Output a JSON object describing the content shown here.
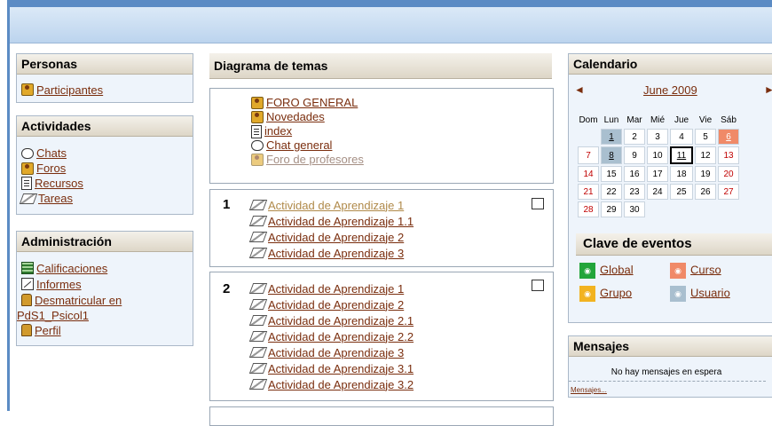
{
  "left": {
    "personas": {
      "title": "Personas",
      "items": [
        {
          "label": "Participantes",
          "icon": "people-icon"
        }
      ]
    },
    "actividades": {
      "title": "Actividades",
      "items": [
        {
          "label": "Chats",
          "icon": "chat-icon"
        },
        {
          "label": "Foros",
          "icon": "people-icon"
        },
        {
          "label": "Recursos",
          "icon": "document-icon"
        },
        {
          "label": "Tareas",
          "icon": "assignment-icon"
        }
      ]
    },
    "administracion": {
      "title": "Administración",
      "items": [
        {
          "label": "Calificaciones",
          "icon": "grades-icon"
        },
        {
          "label": "Informes",
          "icon": "report-icon"
        },
        {
          "label": "Desmatricular en",
          "label2": "PdS1_Psicol1",
          "icon": "person-icon"
        },
        {
          "label": "Perfil",
          "icon": "person-icon"
        }
      ]
    }
  },
  "center": {
    "title": "Diagrama de temas",
    "section0": [
      {
        "label": "FORO GENERAL",
        "icon": "people-icon"
      },
      {
        "label": "Novedades",
        "icon": "people-icon"
      },
      {
        "label": "index",
        "icon": "document-icon"
      },
      {
        "label": "Chat general",
        "icon": "chat-icon"
      },
      {
        "label": "Foro de profesores",
        "icon": "people-icon",
        "dimmed": true
      }
    ],
    "section1": {
      "number": "1",
      "items": [
        "Actividad de Aprendizaje 1",
        "Actividad de Aprendizaje 1.1",
        "Actividad de Aprendizaje 2",
        "Actividad de Aprendizaje 3"
      ]
    },
    "section2": {
      "number": "2",
      "items": [
        "Actividad de Aprendizaje 1",
        "Actividad de Aprendizaje 2",
        "Actividad de Aprendizaje 2.1",
        "Actividad de Aprendizaje 2.2",
        "Actividad de Aprendizaje 3",
        "Actividad de Aprendizaje 3.1",
        "Actividad de Aprendizaje 3.2"
      ]
    }
  },
  "right": {
    "calendar": {
      "title": "Calendario",
      "month": "June 2009",
      "prev": "◄",
      "next": "►",
      "weekdays": [
        "Dom",
        "Lun",
        "Mar",
        "Mié",
        "Jue",
        "Vie",
        "Sáb"
      ],
      "weeks": [
        [
          "",
          "1",
          "2",
          "3",
          "4",
          "5",
          "6"
        ],
        [
          "7",
          "8",
          "9",
          "10",
          "11",
          "12",
          "13"
        ],
        [
          "14",
          "15",
          "16",
          "17",
          "18",
          "19",
          "20"
        ],
        [
          "21",
          "22",
          "23",
          "24",
          "25",
          "26",
          "27"
        ],
        [
          "28",
          "29",
          "30",
          "",
          "",
          "",
          ""
        ]
      ]
    },
    "events_key": {
      "title": "Clave de eventos",
      "items": [
        {
          "label": "Global",
          "color": "#22a53a"
        },
        {
          "label": "Curso",
          "color": "#f08a68"
        },
        {
          "label": "Grupo",
          "color": "#f2b320"
        },
        {
          "label": "Usuario",
          "color": "#a9bfcf"
        }
      ]
    },
    "messages": {
      "title": "Mensajes",
      "text": "No hay mensajes en espera",
      "link": "Mensajes..."
    }
  },
  "colors": {
    "frame": "#5b8bc4",
    "link": "#7a2e0e",
    "block_bg": "#eef4fb"
  }
}
